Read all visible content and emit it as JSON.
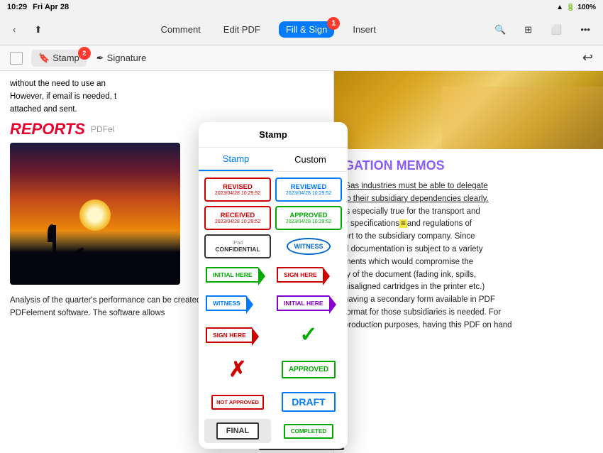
{
  "statusBar": {
    "time": "10:29",
    "day": "Fri Apr 28",
    "battery": "100%",
    "wifi": true
  },
  "toolbar": {
    "backIcon": "chevron-left",
    "shareIcon": "share",
    "commentLabel": "Comment",
    "editPdfLabel": "Edit PDF",
    "fillSignLabel": "Fill & Sign",
    "insertLabel": "Insert",
    "searchIcon": "search",
    "gridIcon": "grid",
    "menuIcon": "menu",
    "undoIcon": "undo",
    "badge1": "1",
    "badge2": "2"
  },
  "subToolbar": {
    "stampLabel": "Stamp",
    "signatureLabel": "Signature"
  },
  "stampPopup": {
    "title": "Stamp",
    "tab1": "Stamp",
    "tab2": "Custom",
    "items": [
      {
        "id": "revised",
        "label": "REVISED",
        "date": "2023/04/28 10:29:52",
        "type": "revised"
      },
      {
        "id": "reviewed",
        "label": "REVIEWED",
        "date": "2023/04/28 10:29:52",
        "type": "reviewed"
      },
      {
        "id": "received",
        "label": "RECEIVED",
        "date": "2023/04/28 10:29:52",
        "type": "received"
      },
      {
        "id": "approved-date",
        "label": "APPROVED",
        "date": "2023/04/28 10:29:52",
        "type": "approved-date"
      },
      {
        "id": "confidential",
        "label": "CONFIDENTIAL",
        "sublabel": "iPad",
        "type": "confidential"
      },
      {
        "id": "witness-oval",
        "label": "WITNESS",
        "type": "witness-oval"
      },
      {
        "id": "initial-here-green",
        "label": "INITIAL HERE",
        "type": "arrow-green"
      },
      {
        "id": "sign-here-red",
        "label": "SIGN HERE",
        "type": "arrow-red"
      },
      {
        "id": "witness-arrow",
        "label": "WITNESS",
        "type": "arrow-blue"
      },
      {
        "id": "initial-here-purple",
        "label": "INITIAL HERE",
        "type": "arrow-purple"
      },
      {
        "id": "sign-here-arrow2",
        "label": "SIGN HERE",
        "type": "arrow-red2"
      },
      {
        "id": "checkmark",
        "label": "✓",
        "type": "checkmark"
      },
      {
        "id": "crossmark",
        "label": "✗",
        "type": "crossmark"
      },
      {
        "id": "approved-box",
        "label": "APPROVED",
        "type": "approved-box"
      },
      {
        "id": "not-approved",
        "label": "NOT APPROVED",
        "type": "not-approved"
      },
      {
        "id": "draft",
        "label": "DRAFT",
        "type": "draft"
      },
      {
        "id": "final",
        "label": "FINAL",
        "type": "final"
      },
      {
        "id": "completed",
        "label": "COMPLETED",
        "type": "completed"
      }
    ]
  },
  "leftDoc": {
    "paragraphText": "without the need to use an However, if email is needed, t attached and sent.",
    "heading": "REPORTS",
    "pdfElementText": "PDFel",
    "bottomText": "Analysis of the quarter's performance can be created quickly and efficiently with the PDFelement software. The software allows"
  },
  "rightDoc": {
    "heading": "GATION MEMOS",
    "paragraph1": "Gas industries must be able to delegate to their subsidiary dependencies clearly. is especially true for the transport and y specifications and regulations of ort to the subsidiary company. Since d documentation is subject to a variety ments which would compromise the ty of the document (fading ink, spills, nisaligned cartridges in the printer etc.) having a secondary form available in PDF format for those subsidiaries is needed. For production purposes, having this PDF on hand"
  }
}
